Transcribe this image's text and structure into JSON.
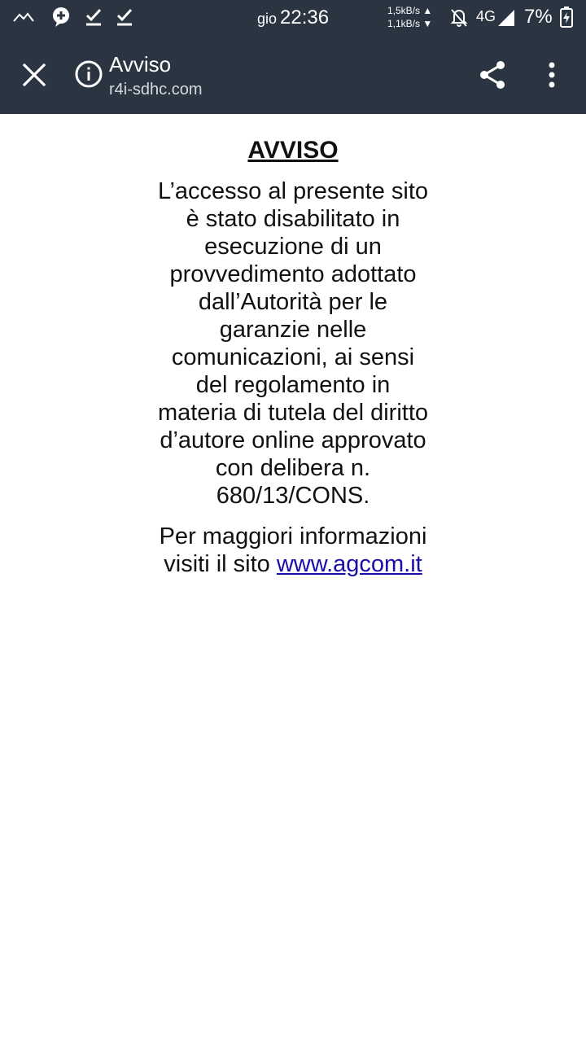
{
  "status_bar": {
    "day": "gio",
    "time": "22:36",
    "upload_speed": "1,5kB/s",
    "download_speed": "1,1kB/s",
    "network": "4G",
    "battery": "7%",
    "icons": [
      "mountain-icon",
      "chat-plus-icon",
      "download-done-icon",
      "download-done-icon",
      "mute-icon",
      "signal-icon",
      "battery-charging-icon"
    ]
  },
  "toolbar": {
    "title": "Avviso",
    "url": "r4i-sdhc.com",
    "icons": [
      "close-icon",
      "info-icon",
      "share-icon",
      "more-vert-icon"
    ]
  },
  "notice": {
    "title": "AVVISO",
    "body": "L’accesso al presente sito è stato disabilitato in esecuzione di un provvedimento adottato dall’Autorità per le garanzie nelle comunicazioni, ai sensi del regolamento in materia di tutela del diritto d’autore online approvato con delibera n. 680/13/CONS.",
    "more_prefix": "Per maggiori informazioni visiti il sito",
    "link_text": "www.agcom.it"
  },
  "colors": {
    "bar_background": "#2b3441",
    "link": "#1a0dab"
  }
}
